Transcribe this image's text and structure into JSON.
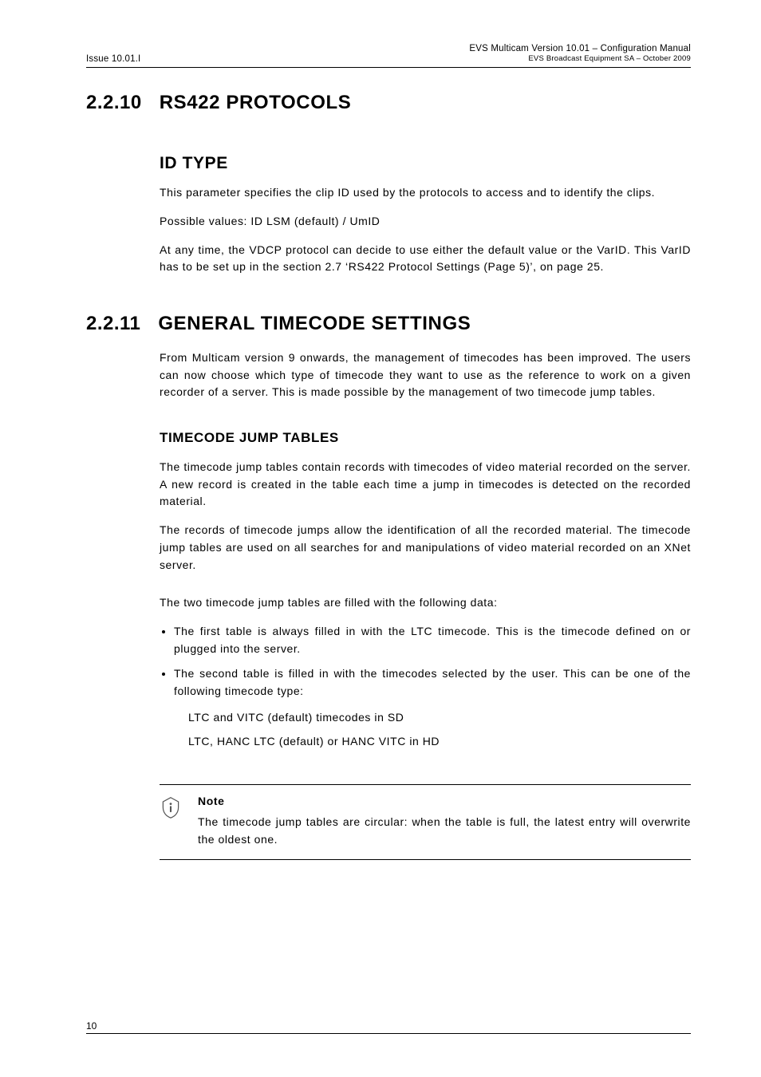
{
  "header": {
    "issue": "Issue 10.01.I",
    "title": "EVS Multicam Version 10.01 – Configuration Manual",
    "subtitle": "EVS Broadcast Equipment SA – October 2009"
  },
  "sec_2_2_10": {
    "num": "2.2.10",
    "title": "RS422 PROTOCOLS",
    "id_type": {
      "heading": "ID TYPE",
      "p1": "This parameter specifies the clip ID used by the protocols to access and to identify the clips.",
      "p2": "Possible values: ID LSM (default) / UmID",
      "p3": "At any time, the VDCP protocol can decide to use either the default value or the VarID. This VarID has to be set up in the section 2.7 ‘RS422 Protocol Settings (Page 5)’, on page 25."
    }
  },
  "sec_2_2_11": {
    "num": "2.2.11",
    "title": "GENERAL TIMECODE SETTINGS",
    "intro": "From Multicam version 9 onwards, the management of timecodes has been improved. The users can now choose which type of timecode they want to use as the reference to work on a given recorder of a server. This is made possible by the management of two timecode jump tables.",
    "tjt": {
      "heading": "TIMECODE JUMP TABLES",
      "p1": "The timecode jump tables contain records with timecodes of video material recorded on the server. A new record is created in the table each time a jump in timecodes is detected on the recorded material.",
      "p2": "The records of timecode jumps allow the identification of all the recorded material. The timecode jump tables are used on all searches for and manipulations of video material recorded on an XNet server.",
      "p3": "The two timecode jump tables are filled with the following data:",
      "bullets": {
        "b1": "The first table is always filled in with the LTC timecode. This is the timecode defined on or plugged into the server.",
        "b2": "The second table is filled in with the timecodes selected by the user. This can be one of the following timecode type:"
      },
      "sub": {
        "s1": "LTC and VITC (default) timecodes in SD",
        "s2": "LTC, HANC LTC (default) or HANC VITC in HD"
      }
    }
  },
  "note": {
    "title": "Note",
    "body": "The timecode jump tables are circular: when the table is full, the latest entry will overwrite the oldest one."
  },
  "footer": {
    "page": "10"
  }
}
